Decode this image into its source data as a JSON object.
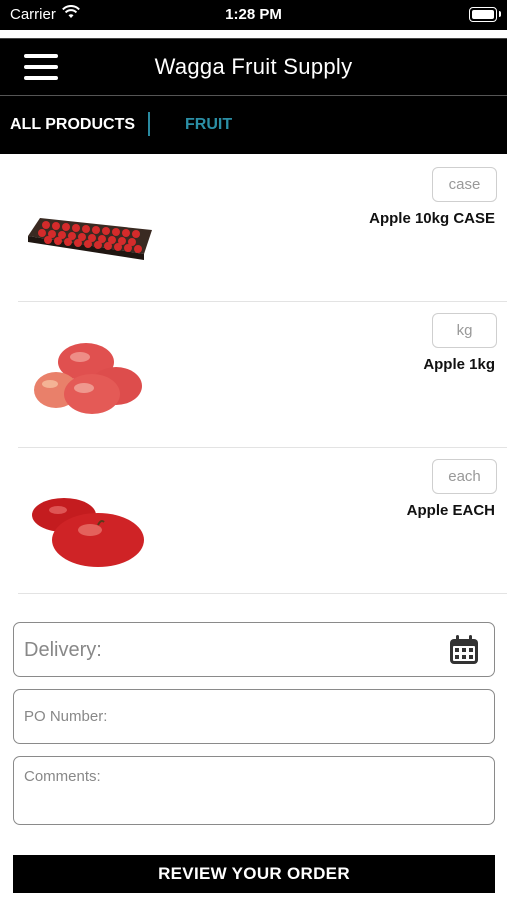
{
  "status_bar": {
    "carrier": "Carrier",
    "time": "1:28 PM"
  },
  "header": {
    "title": "Wagga Fruit Supply"
  },
  "tabs": [
    {
      "label": "ALL PRODUCTS"
    },
    {
      "label": "FRUIT"
    }
  ],
  "products": [
    {
      "unit": "case",
      "name": "Apple 10kg CASE"
    },
    {
      "unit": "kg",
      "name": "Apple 1kg"
    },
    {
      "unit": "each",
      "name": "Apple EACH"
    }
  ],
  "form": {
    "delivery_placeholder": "Delivery:",
    "po_placeholder": "PO Number:",
    "comments_placeholder": "Comments:"
  },
  "review_button": "REVIEW YOUR ORDER",
  "colors": {
    "accent": "#2b8fa6",
    "bar": "#000000"
  }
}
